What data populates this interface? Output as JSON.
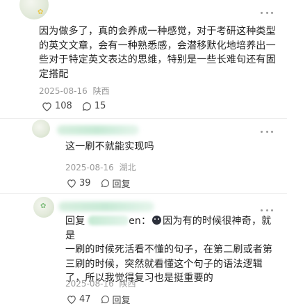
{
  "comments": [
    {
      "text_lines": [
        "因为做多了，真的会养成一种感觉，对于考研这种类型",
        "的英文文章，会有一种熟悉感，会潜移默化地培养出一",
        "些对于特定英文表达的思维，特别是一些长难句还有固",
        "定搭配"
      ],
      "date": "2025-08-16",
      "location": "陕西",
      "likes": "108",
      "replies": "15"
    },
    {
      "text": "这一刷不就能实现吗",
      "date": "2025-08-16",
      "location": "湖北",
      "likes": "39",
      "reply_label": "回复"
    },
    {
      "reply_prefix": "回复",
      "mention_suffix": "en：",
      "text_first": "因为有的时候很神奇，就是",
      "text_lines": [
        "一刷的时候死活看不懂的句子，在第二刷或者第",
        "三刷的时候，突然就看懂这个句子的语法逻辑",
        "了，所以我觉得复习也是挺重要的"
      ],
      "date": "2025-08-16",
      "location": "陕西",
      "likes": "47",
      "reply_label": "回复"
    }
  ]
}
